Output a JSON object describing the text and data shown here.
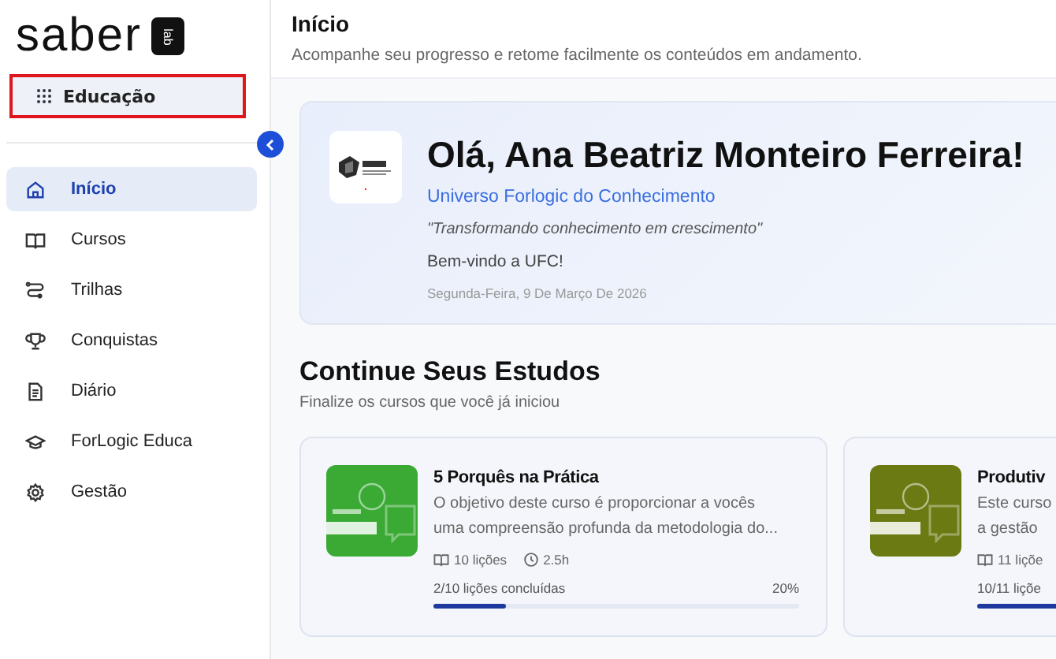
{
  "sidebar": {
    "logo": "saber",
    "logo_badge": "lab",
    "workspace_button": {
      "label": "Educação",
      "highlighted": true
    },
    "items": [
      {
        "label": "Início",
        "selected": true
      },
      {
        "label": "Cursos",
        "selected": false
      },
      {
        "label": "Trilhas",
        "selected": false
      },
      {
        "label": "Conquistas",
        "selected": false
      },
      {
        "label": "Diário",
        "selected": false
      },
      {
        "label": "ForLogic Educa",
        "selected": false
      },
      {
        "label": "Gestão",
        "selected": false
      }
    ]
  },
  "header": {
    "title": "Início",
    "subtitle": "Acompanhe seu progresso e retome facilmente os conteúdos em andamento."
  },
  "welcome": {
    "greeting": "Olá, Ana Beatriz Monteiro Ferreira!",
    "organization": "Universo Forlogic do Conhecimento",
    "motto": "\"Transformando conhecimento em crescimento\"",
    "message": "Bem-vindo a UFC!",
    "date": "Segunda-Feira, 9 De Março De 2026"
  },
  "continue": {
    "title": "Continue Seus Estudos",
    "subtitle": "Finalize os cursos que você já iniciou",
    "courses": [
      {
        "title": "5 Porquês na Prática",
        "description_lines": [
          "O objetivo deste curso é proporcionar a vocês",
          "uma compreensão profunda da metodologia do..."
        ],
        "lessons": "10 lições",
        "duration": "2.5h",
        "progress_text": "2/10 lições concluídas",
        "percent": "20%",
        "level": 0.2,
        "color": "#3aaa35"
      },
      {
        "title": "Produtiv",
        "description_lines": [
          "Este curso",
          "a gestão"
        ],
        "lessons": "11 liçõe",
        "progress_text": "10/11 liçõe",
        "level": 0.91,
        "color": "#6b7a12"
      }
    ]
  }
}
